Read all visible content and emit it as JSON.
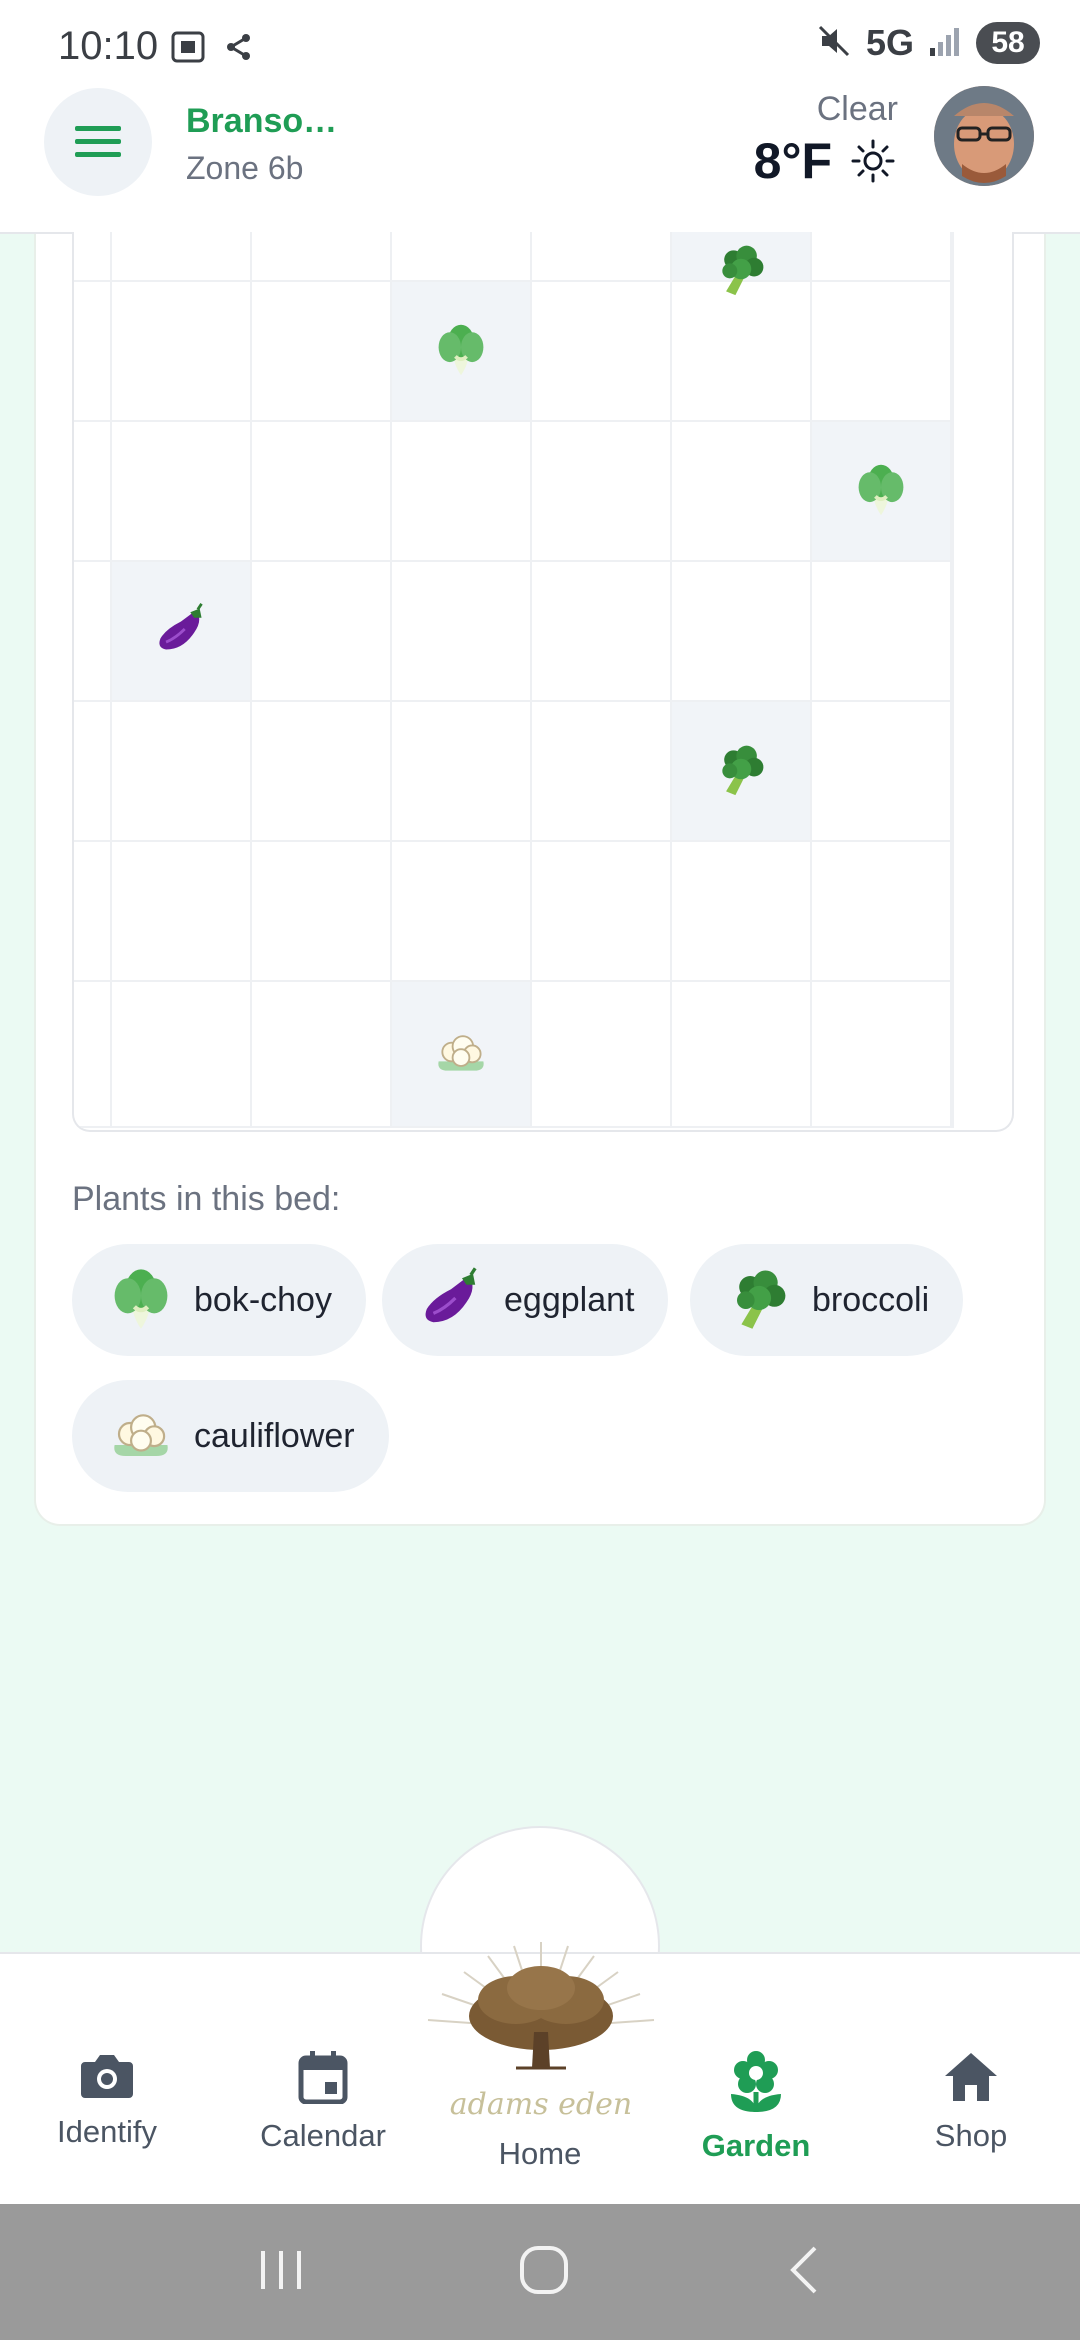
{
  "status_bar": {
    "time": "10:10",
    "network": "5G",
    "battery": "58"
  },
  "header": {
    "location_name": "Branso…",
    "zone": "Zone 6b",
    "weather_condition": "Clear",
    "temperature": "8°F"
  },
  "bed": {
    "plants_label": "Plants in this bed:",
    "plants": [
      {
        "name": "bok-choy",
        "icon": "bok-choy-icon"
      },
      {
        "name": "eggplant",
        "icon": "eggplant-icon"
      },
      {
        "name": "broccoli",
        "icon": "broccoli-icon"
      },
      {
        "name": "cauliflower",
        "icon": "cauliflower-icon"
      }
    ],
    "grid_cells": [
      {
        "row": 0,
        "col": 4,
        "plant": "broccoli"
      },
      {
        "row": 1,
        "col": 2,
        "plant": "bok-choy"
      },
      {
        "row": 2,
        "col": 5,
        "plant": "bok-choy"
      },
      {
        "row": 3,
        "col": 0,
        "plant": "eggplant"
      },
      {
        "row": 4,
        "col": 4,
        "plant": "broccoli"
      },
      {
        "row": 6,
        "col": 2,
        "plant": "cauliflower"
      }
    ]
  },
  "nav": {
    "identify": "Identify",
    "calendar": "Calendar",
    "home": "Home",
    "garden": "Garden",
    "shop": "Shop",
    "active": "Garden"
  },
  "logo_text": "adams eden",
  "colors": {
    "accent": "#1f9d55",
    "background": "#ebfaf3",
    "chip": "#eef2f6"
  }
}
